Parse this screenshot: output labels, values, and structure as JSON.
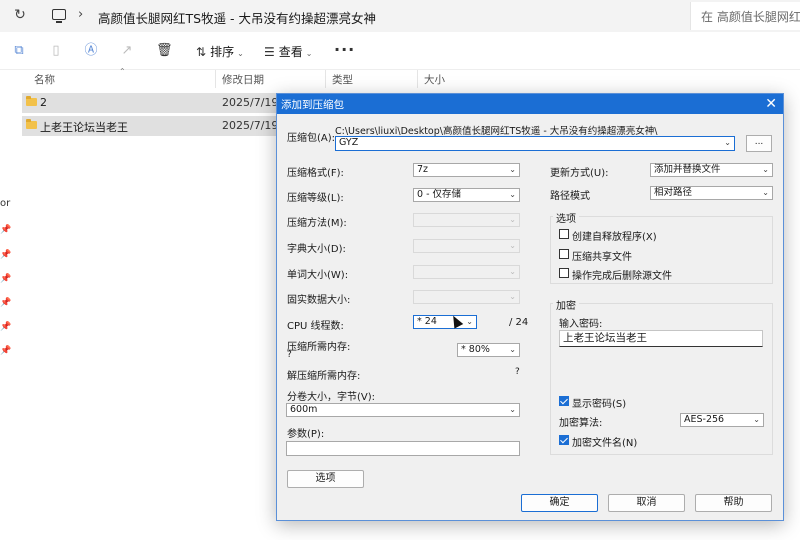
{
  "explorer": {
    "address_path": "高颜值长腿网红TS牧遥 - 大吊没有约操超漂亮女神",
    "search_placeholder": "在 高颜值长腿网红TS牧遥",
    "toolbar": {
      "sort_label": "排序",
      "view_label": "查看",
      "more_label": "···"
    },
    "nav_partial_text": "or",
    "columns": {
      "name": "名称",
      "date": "修改日期",
      "type": "类型",
      "size": "大小"
    },
    "files": [
      {
        "name": "2",
        "date": "2025/7/19 1"
      },
      {
        "name": "上老王论坛当老王",
        "date": "2025/7/19 1"
      }
    ]
  },
  "dialog": {
    "title": "添加到压缩包",
    "archive_label": "压缩包(A):",
    "archive_dir": "C:\\Users\\liuxi\\Desktop\\高颜值长腿网红TS牧遥 - 大吊没有约操超漂亮女神\\",
    "archive_name": "GYZ",
    "browse_label": "...",
    "format_label": "压缩格式(F):",
    "format_value": "7z",
    "level_label": "压缩等级(L):",
    "level_value": "0 - 仅存储",
    "method_label": "压缩方法(M):",
    "dict_label": "字典大小(D):",
    "word_label": "单词大小(W):",
    "solid_label": "固实数据大小:",
    "cpu_label": "CPU 线程数:",
    "cpu_value": "* 24",
    "cpu_max": "/ 24",
    "mem_compress_label": "压缩所需内存:",
    "mem_compress_q": "?",
    "mem_compress_value": "* 80%",
    "mem_decompress_label": "解压缩所需内存:",
    "mem_decompress_q": "?",
    "volume_label": "分卷大小，字节(V):",
    "volume_value": "600m",
    "params_label": "参数(P):",
    "options_button": "选项",
    "update_label": "更新方式(U):",
    "update_value": "添加并替换文件",
    "path_mode_label": "路径模式",
    "path_mode_value": "相对路径",
    "options_group": "选项",
    "opt_sfx": "创建自释放程序(X)",
    "opt_shared": "压缩共享文件",
    "opt_delete": "操作完成后删除源文件",
    "encrypt_group": "加密",
    "pwd_label": "输入密码:",
    "pwd_value": "上老王论坛当老王",
    "show_pwd_label": "显示密码(S)",
    "enc_method_label": "加密算法:",
    "enc_method_value": "AES-256",
    "enc_names_label": "加密文件名(N)",
    "ok_label": "确定",
    "cancel_label": "取消",
    "help_label": "帮助"
  },
  "colors": {
    "accent": "#1b6ed4",
    "folder": "#f2c14a",
    "selected_row": "#e0e0e0"
  }
}
